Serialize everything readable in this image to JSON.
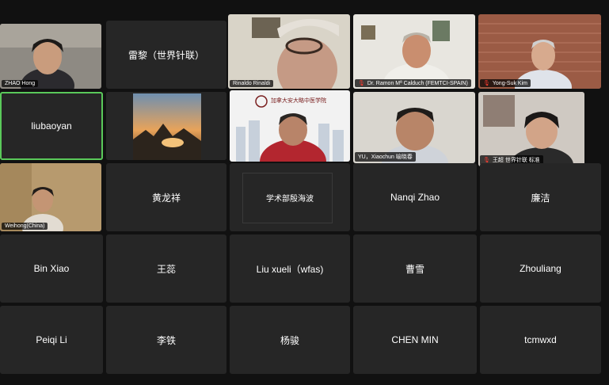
{
  "participants": {
    "r1c1": "ZHAO Hong",
    "r1c2": "雷黎（世界针联）",
    "r1c3": "Rinaldo Rinaldi",
    "r1c4": "Dr. Ramon Mª Calduch (FEMTCI-SPAIN)",
    "r1c5": "Yong-Suk Kim",
    "r2c1": "liubaoyan",
    "r2c3_banner": "加拿大安大略中医学院",
    "r2c4": "YU，Xiaochun 喻晓春",
    "r2c5": "王超 世界针联 标准",
    "r3c1": "Weihong(China)",
    "r3c2": "黄龙祥",
    "r3c3": "学术部殷海波",
    "r3c4": "Nanqi Zhao",
    "r3c5": "廉洁",
    "r4c1": "Bin Xiao",
    "r4c2": "王蕊",
    "r4c3": "Liu xueli（wfas)",
    "r4c4": "曹雪",
    "r4c5": "Zhouliang",
    "r5c1": "Peiqi Li",
    "r5c2": "李铁",
    "r5c3": "杨骏",
    "r5c4": "CHEN MIN",
    "r5c5": "tcmwxd"
  },
  "colors": {
    "background": "#111111",
    "tile": "#262626",
    "active_border": "#5ac95a",
    "muted_mic": "#ff3b30"
  }
}
